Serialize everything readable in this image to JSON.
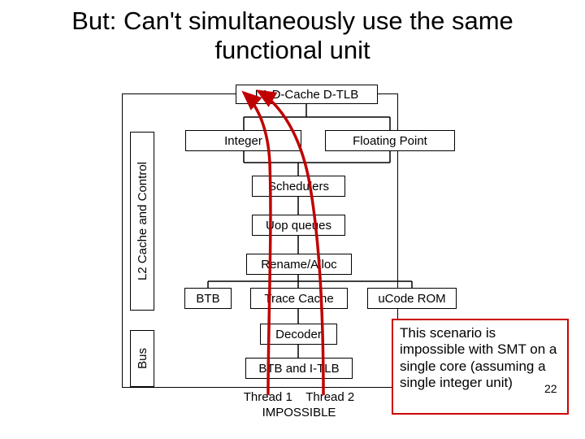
{
  "title": "But: Can't simultaneously use  the same functional unit",
  "blocks": {
    "l1": "L1 D-Cache D-TLB",
    "integer": "Integer",
    "fp": "Floating Point",
    "schedulers": "Schedulers",
    "uopq": "Uop queues",
    "rename": "Rename/Alloc",
    "btb": "BTB",
    "trace": "Trace Cache",
    "ucode": "uCode ROM",
    "decoder": "Decoder",
    "btb2": "BTB and I-TLB",
    "l2": "L2 Cache and Control",
    "bus": "Bus"
  },
  "threads": {
    "t1": "Thread 1",
    "t2": "Thread 2",
    "impossible": "IMPOSSIBLE"
  },
  "note": "This scenario is impossible with SMT on a single core (assuming a single integer unit)",
  "pagenum": "22"
}
